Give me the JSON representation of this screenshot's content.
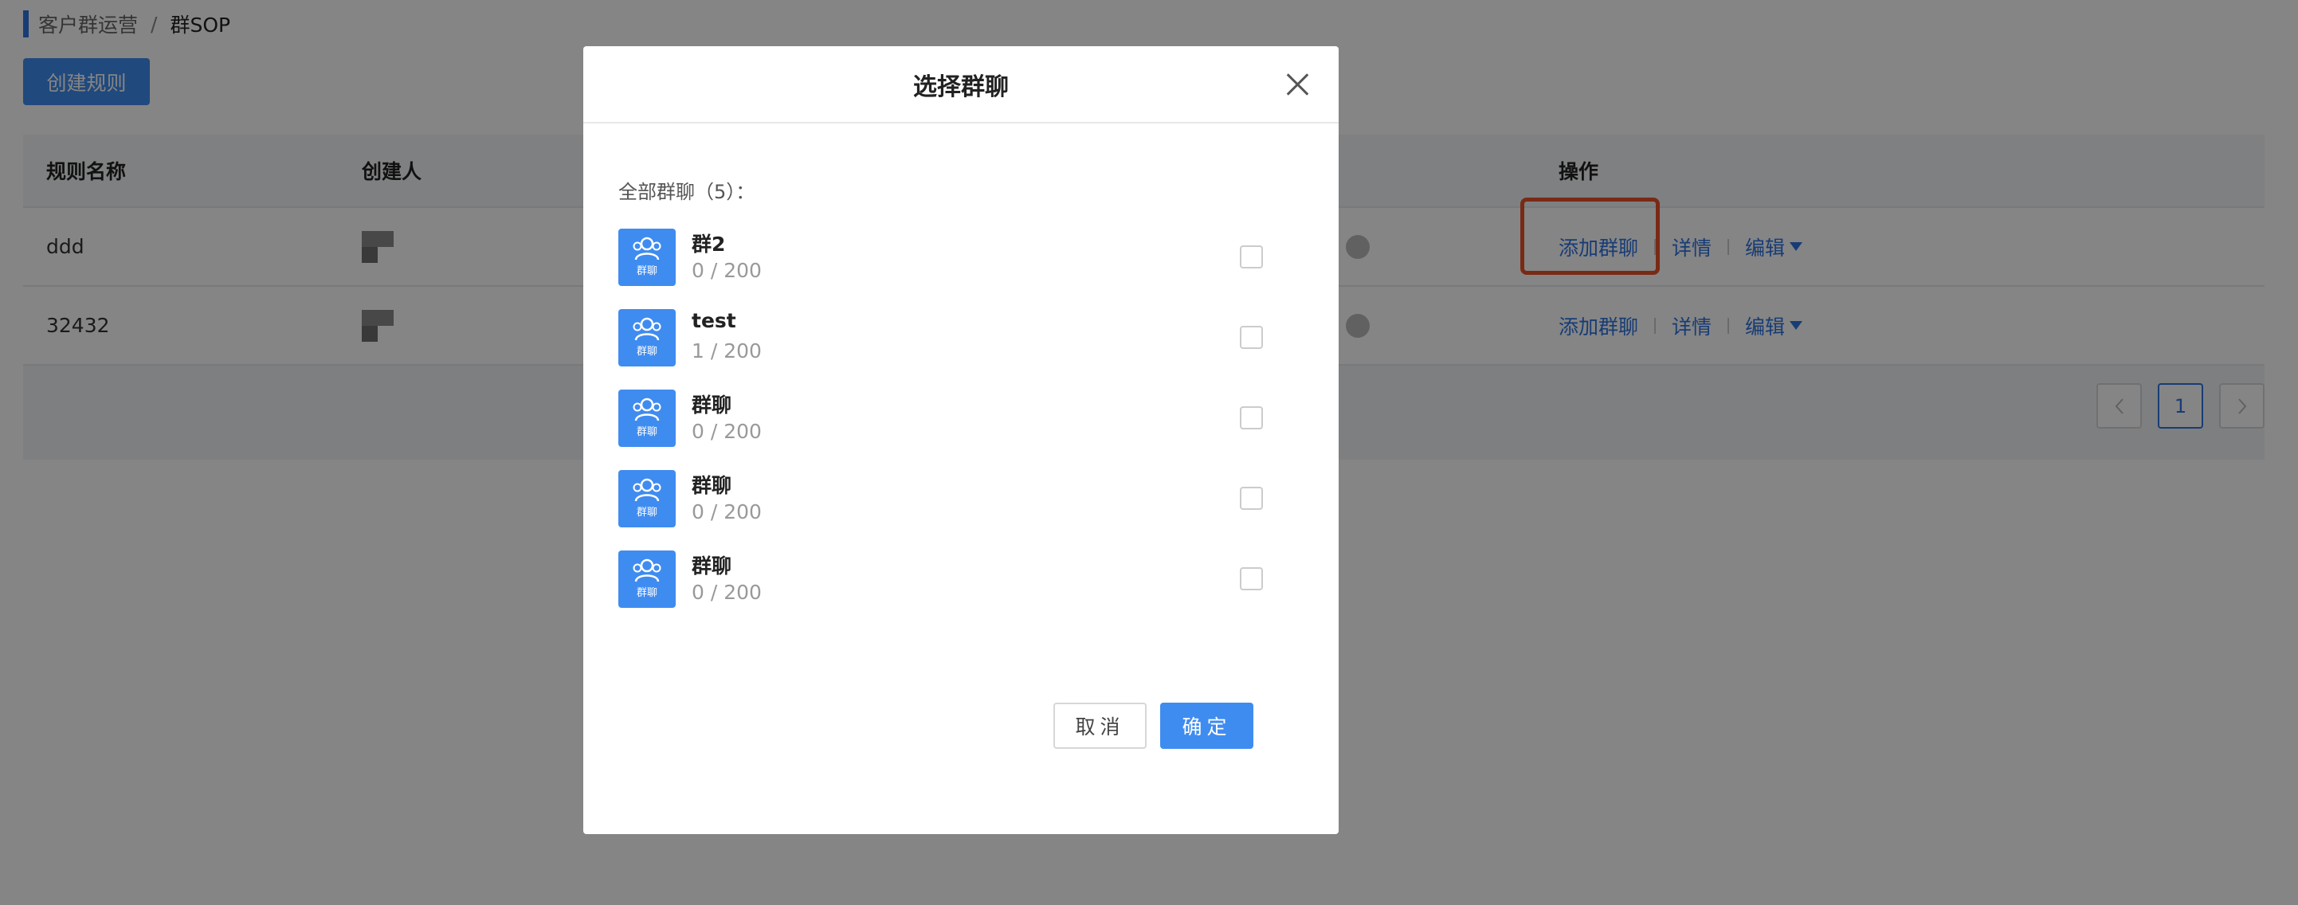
{
  "breadcrumb": {
    "parent": "客户群运营",
    "separator": "/",
    "current": "群SOP"
  },
  "toolbar": {
    "create_label": "创建规则"
  },
  "table": {
    "headers": {
      "name": "规则名称",
      "creator": "创建人",
      "operation": "操作"
    },
    "rows": [
      {
        "name": "ddd",
        "ops": {
          "add": "添加群聊",
          "detail": "详情",
          "edit": "编辑"
        }
      },
      {
        "name": "32432",
        "ops": {
          "add": "添加群聊",
          "detail": "详情",
          "edit": "编辑"
        }
      }
    ]
  },
  "pagination": {
    "current_page": "1",
    "prev_icon": "chevron-left-icon",
    "next_icon": "chevron-right-icon"
  },
  "modal": {
    "title": "选择群聊",
    "all_label": "全部群聊（5）：",
    "icon_text": "群聊",
    "groups": [
      {
        "name": "群2",
        "count": "0 / 200"
      },
      {
        "name": "test",
        "count": "1 / 200"
      },
      {
        "name": "群聊",
        "count": "0 / 200"
      },
      {
        "name": "群聊",
        "count": "0 / 200"
      },
      {
        "name": "群聊",
        "count": "0 / 200"
      }
    ],
    "cancel_label": "取消",
    "ok_label": "确定"
  },
  "colors": {
    "accent": "#3f8cf0",
    "highlight": "#e8522a"
  }
}
